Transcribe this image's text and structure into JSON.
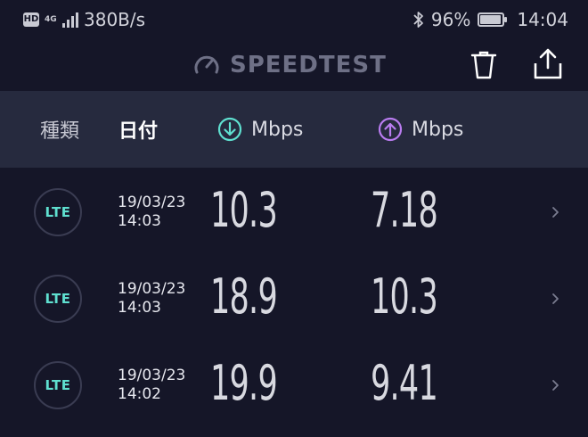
{
  "status_bar": {
    "hd": "HD",
    "network": "4G",
    "speed": "380B/s",
    "battery": "96%",
    "battery_level": 0.96,
    "time": "14:04"
  },
  "app_bar": {
    "title": "SPEEDTEST",
    "icons": [
      "speedometer-icon",
      "trash-icon",
      "share-icon"
    ]
  },
  "table_header": {
    "type_label": "種類",
    "date_label": "日付",
    "download_label": "Mbps",
    "upload_label": "Mbps"
  },
  "colors": {
    "background": "#151628",
    "header_band": "#262a3e",
    "download_accent": "#5fe0d0",
    "upload_accent": "#b97cf0",
    "badge_text": "#5fe0d0"
  },
  "rows": [
    {
      "type": "LTE",
      "date": "19/03/23",
      "time": "14:03",
      "download": "10.3",
      "upload": "7.18"
    },
    {
      "type": "LTE",
      "date": "19/03/23",
      "time": "14:03",
      "download": "18.9",
      "upload": "10.3"
    },
    {
      "type": "LTE",
      "date": "19/03/23",
      "time": "14:02",
      "download": "19.9",
      "upload": "9.41"
    }
  ]
}
